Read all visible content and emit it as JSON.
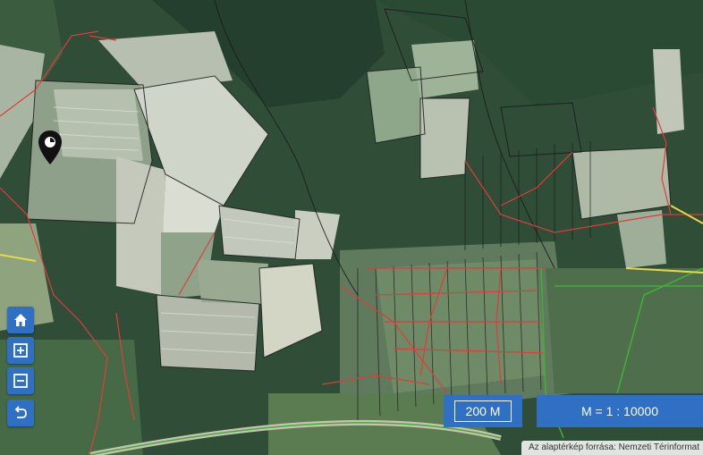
{
  "map": {
    "scale_bar_label": "200 M",
    "scale_ratio_label": "M = 1 : 10000",
    "attribution": "Az alaptérkép forrása: Nemzeti Térinformat",
    "marker_icon": "map-pin-icon"
  },
  "controls": [
    {
      "name": "home-button",
      "icon": "home-icon"
    },
    {
      "name": "zoom-in-button",
      "icon": "plus-square-icon"
    },
    {
      "name": "zoom-out-button",
      "icon": "minus-square-icon"
    },
    {
      "name": "back-button",
      "icon": "undo-arrow-icon"
    }
  ],
  "colors": {
    "forest": "#2d4a34",
    "field_light": "#c9cfc3",
    "parcel_line": "#e23b3b",
    "boundary_green": "#3fae3a",
    "boundary_yellow": "#e7d84a",
    "control_blue": "#2f6fc4"
  }
}
